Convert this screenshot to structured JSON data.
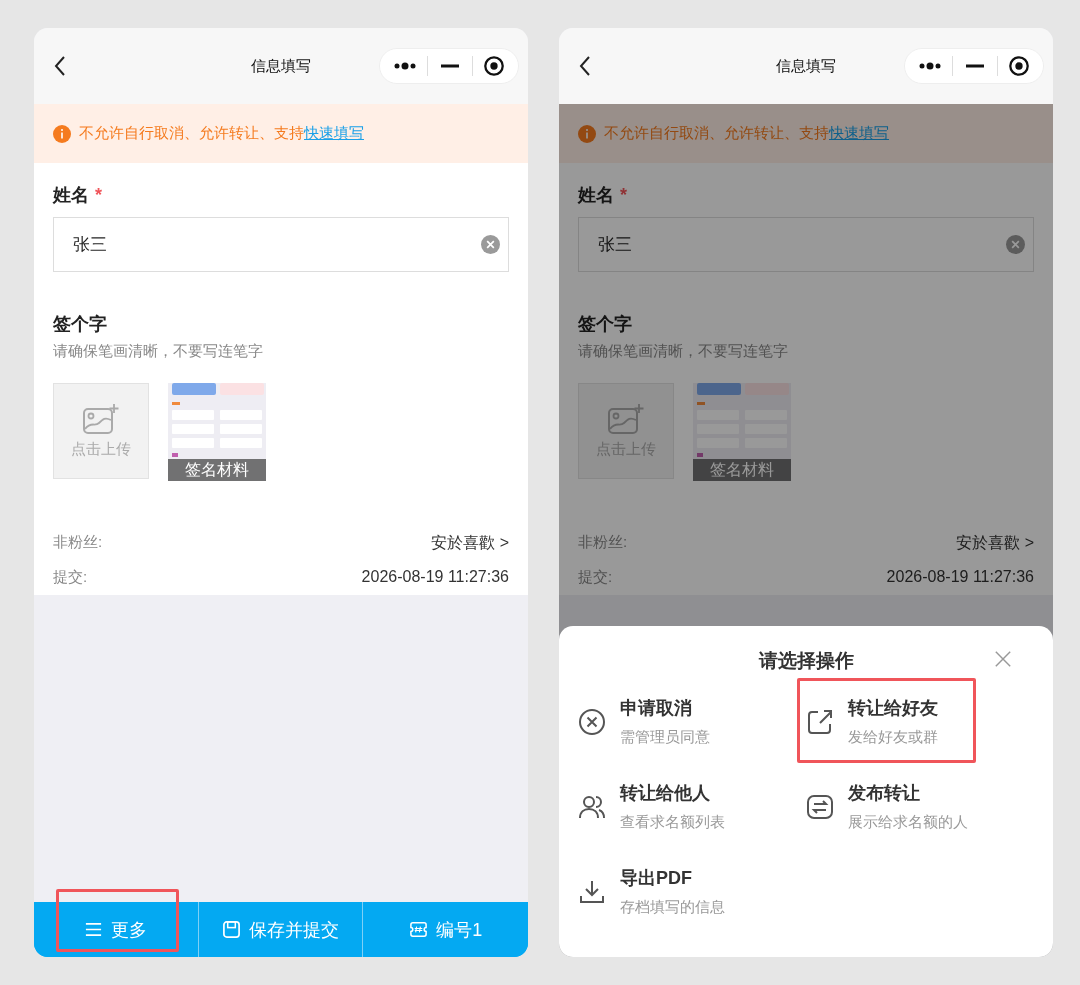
{
  "screens": [
    {
      "nav": {
        "title": "信息填写"
      },
      "notice": {
        "text": "不允许自行取消、允许转让、支持",
        "link": "快速填写"
      },
      "name_field": {
        "label": "姓名",
        "required_mark": "*",
        "value": "张三"
      },
      "signature": {
        "label": "签个字",
        "hint": "请确保笔画清晰，不要写连笔字",
        "upload_label": "点击上传",
        "attachment": {
          "kind": "picture",
          "caption": "签名材料"
        }
      },
      "info_rows": [
        {
          "label": "非粉丝:",
          "value": "安於喜歡 >"
        },
        {
          "label": "提交:",
          "value": "2026-08-19 11:27:36"
        }
      ],
      "bottom_bar": [
        {
          "kind": "menu",
          "label": "更多",
          "highlighted": true
        },
        {
          "kind": "save",
          "label": "保存并提交",
          "highlighted": false
        },
        {
          "kind": "number",
          "label": "编号1",
          "highlighted": false
        }
      ]
    },
    {
      "nav": {
        "title": "信息填写"
      },
      "notice": {
        "text": "不允许自行取消、允许转让、支持",
        "link": "快速填写"
      },
      "name_field": {
        "label": "姓名",
        "required_mark": "*",
        "value": "张三"
      },
      "signature": {
        "label": "签个字",
        "hint": "请确保笔画清晰，不要写连笔字",
        "upload_label": "点击上传",
        "attachment": {
          "kind": "picture",
          "caption": "签名材料"
        }
      },
      "info_rows": [
        {
          "label": "非粉丝:",
          "value": "安於喜歡 >"
        },
        {
          "label": "提交:",
          "value": "2026-08-19 11:27:36"
        }
      ],
      "action_sheet": {
        "title": "请选择操作",
        "actions": [
          {
            "kind": "cancel",
            "title": "申请取消",
            "subtitle": "需管理员同意",
            "highlighted": false
          },
          {
            "kind": "share",
            "title": "转让给好友",
            "subtitle": "发给好友或群",
            "highlighted": true
          },
          {
            "kind": "people",
            "title": "转让给他人",
            "subtitle": "查看求名额列表",
            "highlighted": false
          },
          {
            "kind": "publish",
            "title": "发布转让",
            "subtitle": "展示给求名额的人",
            "highlighted": false
          },
          {
            "kind": "download",
            "title": "导出PDF",
            "subtitle": "存档填写的信息",
            "highlighted": false
          }
        ]
      }
    }
  ]
}
